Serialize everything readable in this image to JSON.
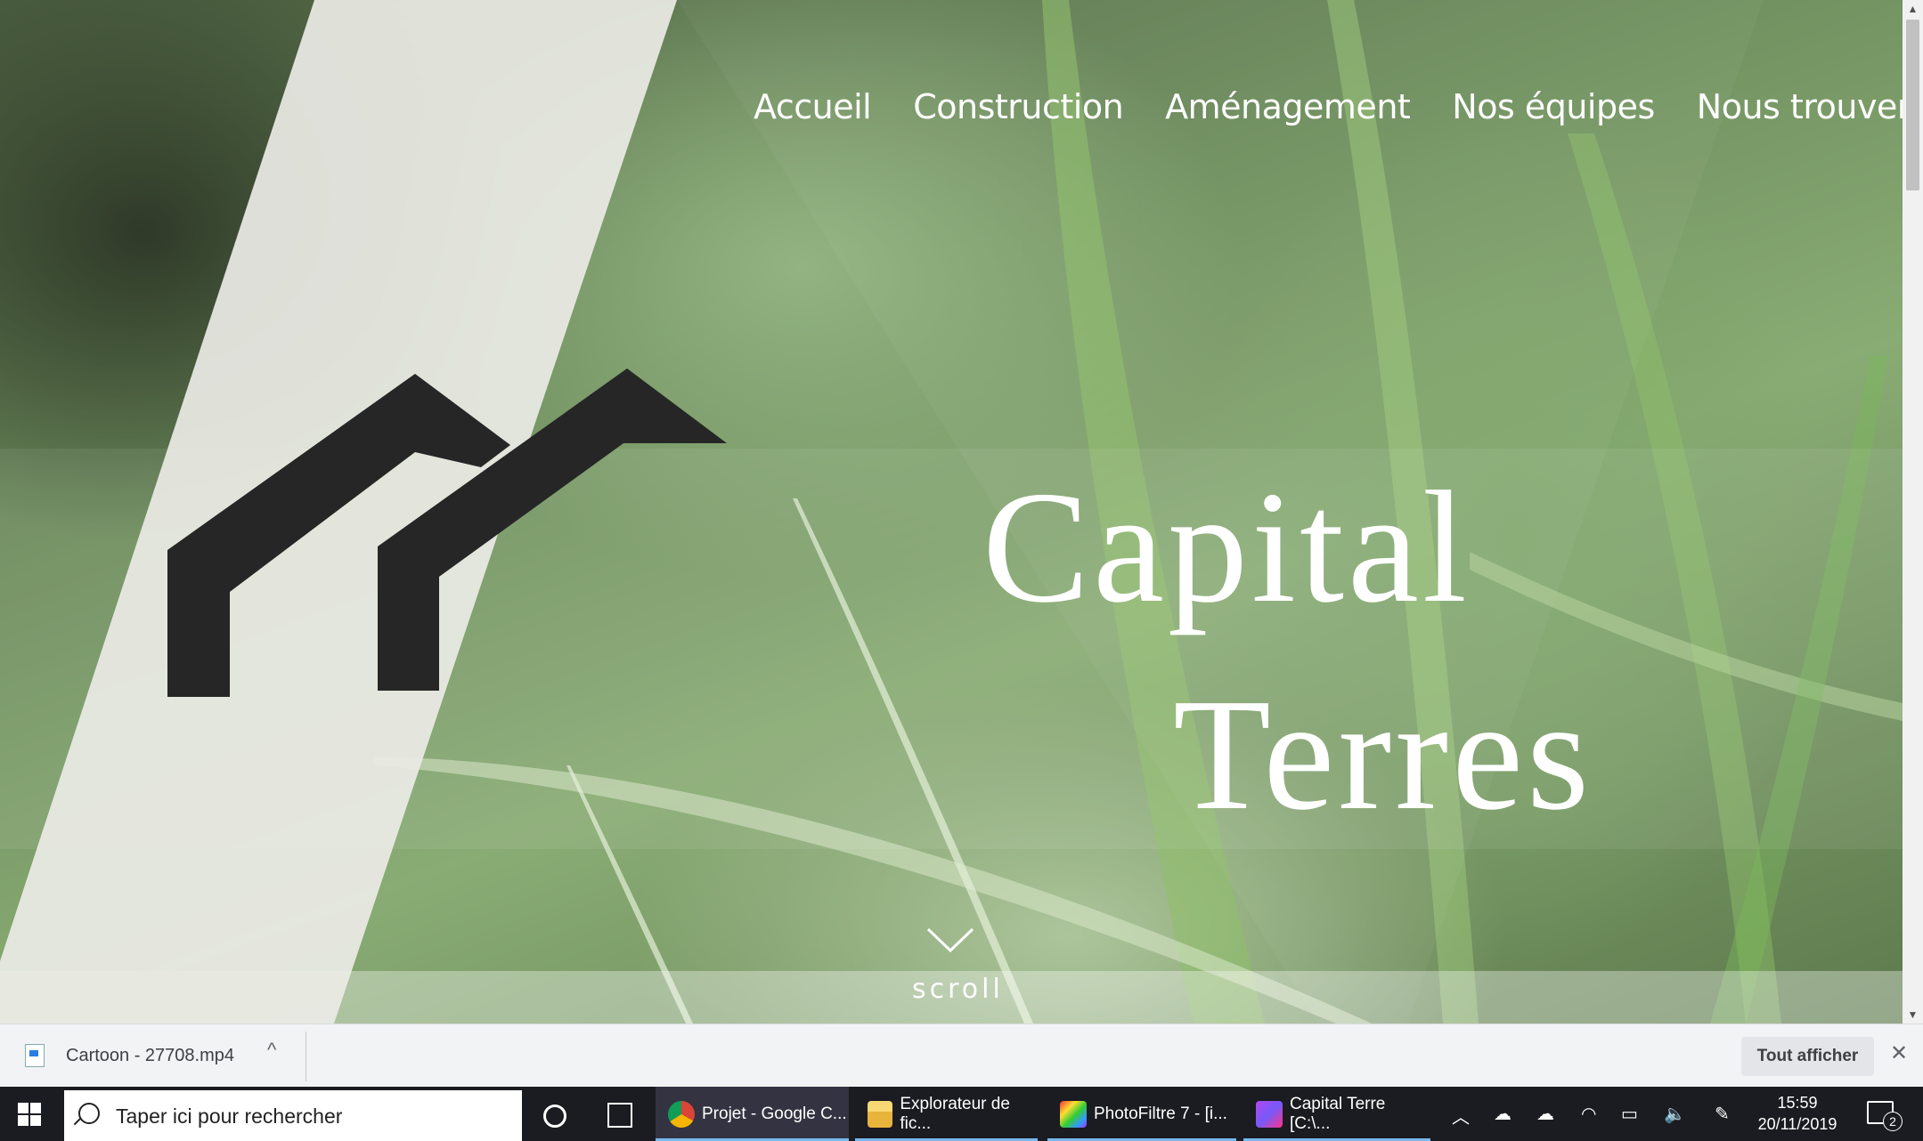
{
  "nav": {
    "items": [
      "Accueil",
      "Construction",
      "Aménagement",
      "Nos équipes",
      "Nous trouver"
    ]
  },
  "hero": {
    "title_line1": "Capital",
    "title_line2": "Terres",
    "scroll_label": "scroll"
  },
  "download_bar": {
    "file_name": "Cartoon - 27708.mp4",
    "show_all_label": "Tout afficher"
  },
  "taskbar": {
    "search_placeholder": "Taper ici pour rechercher",
    "apps": [
      {
        "label": "Projet - Google C...",
        "icon": "chrome-icon"
      },
      {
        "label": "Explorateur de fic...",
        "icon": "folder-icon"
      },
      {
        "label": "PhotoFiltre 7 - [i...",
        "icon": "photofiltre-icon"
      },
      {
        "label": "Capital Terre [C:\\...",
        "icon": "phpstorm-icon"
      }
    ],
    "clock_time": "15:59",
    "clock_date": "20/11/2019",
    "notification_count": "2"
  },
  "colors": {
    "logo": "#262626",
    "diagonal_panel": "#ebebe6",
    "taskbar": "#1b1b22",
    "download_bar": "#f1f3f4"
  }
}
